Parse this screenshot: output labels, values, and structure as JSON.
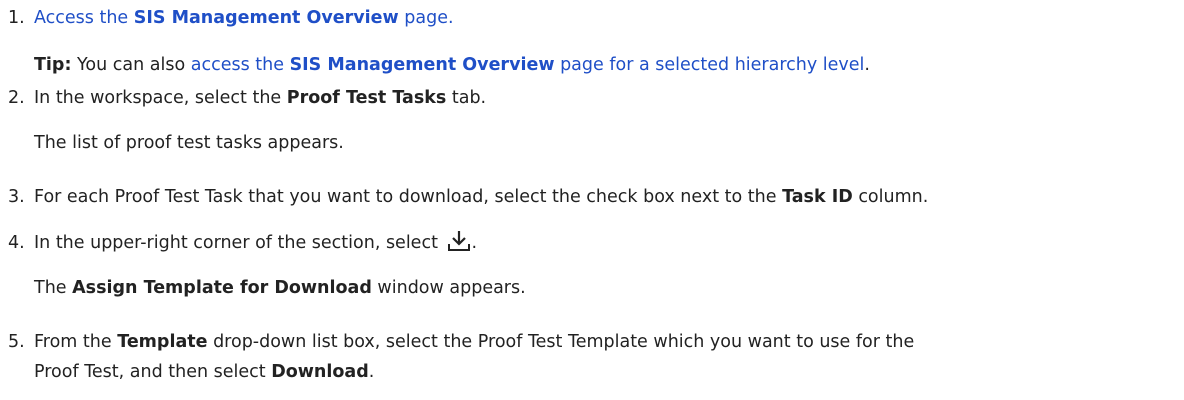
{
  "steps": [
    {
      "number": "1.",
      "pre": "Access the ",
      "bold": "SIS Management Overview",
      "post": " page.",
      "tip": {
        "label": "Tip:",
        "text": " You can also ",
        "link_pre": "access the ",
        "link_bold": "SIS Management Overview",
        "link_post": " page for a selected hierarchy level",
        "end": "."
      }
    },
    {
      "number": "2.",
      "pre": "In the workspace, select the ",
      "bold": "Proof Test Tasks",
      "post": " tab.",
      "result": "The list of proof test tasks appears."
    },
    {
      "number": "3.",
      "pre": "For each Proof Test Task that you want to download, select the check box next to the ",
      "bold": "Task ID",
      "post": " column."
    },
    {
      "number": "4.",
      "pre": "In the upper-right corner of the section, select ",
      "icon": "download-icon",
      "post": ".",
      "result_pre": "The ",
      "result_bold": "Assign Template for Download",
      "result_post": " window appears."
    },
    {
      "number": "5.",
      "pre": "From the ",
      "bold": "Template",
      "mid": " drop-down list box, select the Proof Test Template which you want to use for the",
      "line2_pre": "Proof Test, and then select ",
      "line2_bold": "Download",
      "line2_post": "."
    }
  ],
  "colors": {
    "text": "#222222",
    "link": "#1f4fc7"
  }
}
